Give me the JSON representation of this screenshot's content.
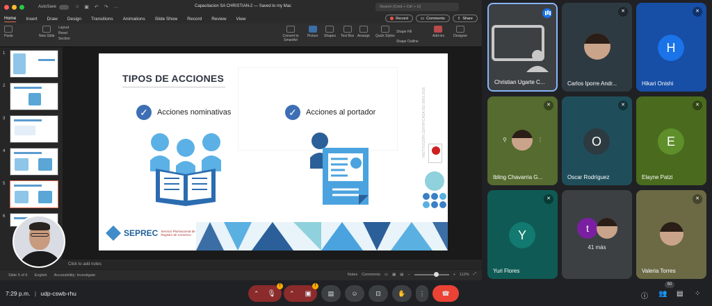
{
  "ppt": {
    "autosave": "AutoSave",
    "doc_title": "Capacitacion SA CHRISTIAN-2  —  Saved to my Mac",
    "search_placeholder": "Search (Cmd + Ctrl + U)",
    "menu": [
      "Home",
      "Insert",
      "Draw",
      "Design",
      "Transitions",
      "Animations",
      "Slide Show",
      "Record",
      "Review",
      "View"
    ],
    "record_label": "Record",
    "comments_label": "Comments",
    "share_label": "Share",
    "ribbon": {
      "paste": "Paste",
      "new_slide": "New Slide",
      "layout": "Layout",
      "reset": "Reset",
      "section": "Section",
      "convert": "Convert to SmartArt",
      "picture": "Picture",
      "shapes": "Shapes",
      "text_box": "Text Box",
      "arrange": "Arrange",
      "quick_styles": "Quick Styles",
      "shape_fill": "Shape Fill",
      "shape_outline": "Shape Outline",
      "addins": "Add-ins",
      "designer": "Designer"
    },
    "thumb_numbers": [
      "1",
      "2",
      "3",
      "4",
      "5",
      "6"
    ],
    "slide": {
      "title": "TIPOS DE ACCIONES",
      "option1": "Acciones nominativas",
      "option2": "Acciones al portador",
      "vertical_text": "INSTITUCIÓN CERTIFICADA ISO 9001:2015",
      "logo_name": "SEPREC",
      "logo_sub": "Servicio Plurinacional de Registro de Comercio"
    },
    "notes_placeholder": "Click to add notes",
    "status": {
      "slide_of": "Slide 5 of 6",
      "language": "English",
      "accessibility": "Accessibility: Investigate",
      "notes": "Notes",
      "comments": "Comments",
      "zoom": "112%"
    }
  },
  "tiles": [
    {
      "name": "Christian Ugarte C..."
    },
    {
      "name": "Carlos Iporre Andr..."
    },
    {
      "name": "Hikari Onishi",
      "initial": "H"
    },
    {
      "name": "Ibling Chavarria G..."
    },
    {
      "name": "Oscar Rodríguez",
      "initial": "O"
    },
    {
      "name": "Elayne Patzi",
      "initial": "E"
    },
    {
      "name": "Yuri Flores",
      "initial": "Y"
    },
    {
      "name": "41 más",
      "initial": "t"
    },
    {
      "name": "Valeria Torres"
    }
  ],
  "bottom": {
    "time": "7:29 p.m.",
    "separator": "|",
    "meeting_code": "udp-cswb-rhu",
    "participants_count": "50"
  },
  "colors": {
    "accent": "#1a73e8",
    "end_call": "#ea4335",
    "slide_blue": "#3d6fb5"
  }
}
